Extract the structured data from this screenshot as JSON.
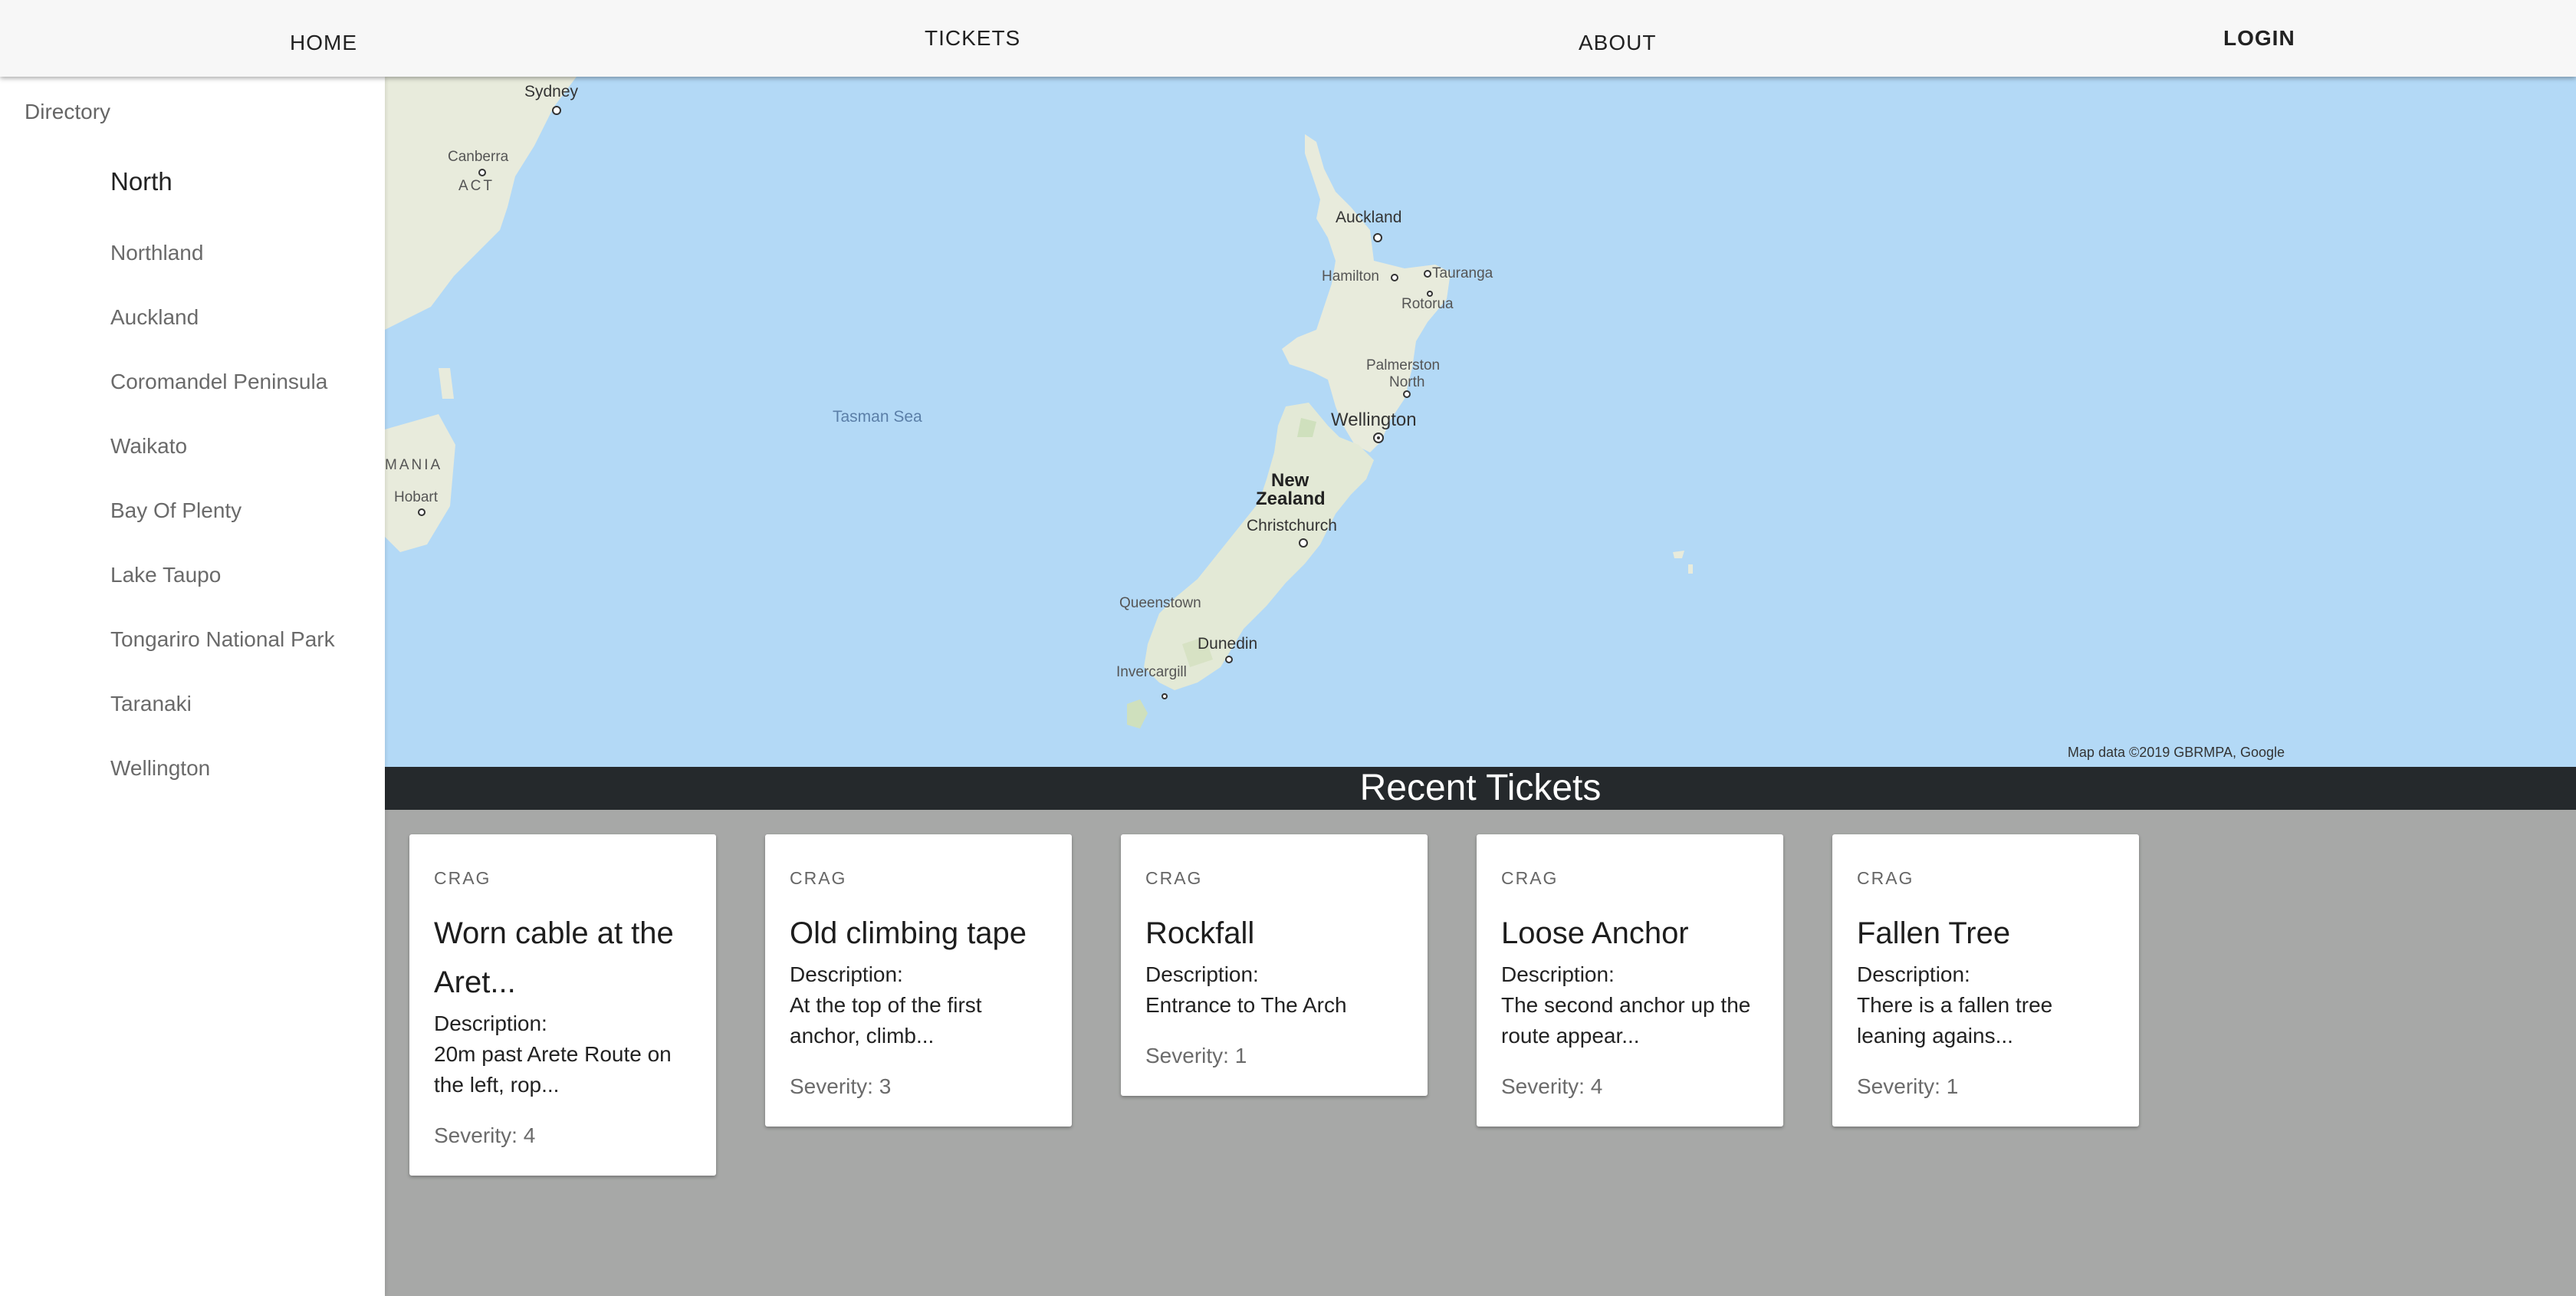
{
  "nav": {
    "home": "HOME",
    "tickets": "TICKETS",
    "about": "ABOUT",
    "login": "LOGIN"
  },
  "sidebar": {
    "directory_label": "Directory",
    "header": "North",
    "items": [
      {
        "label": "Northland"
      },
      {
        "label": "Auckland"
      },
      {
        "label": "Coromandel Peninsula"
      },
      {
        "label": "Waikato"
      },
      {
        "label": "Bay Of Plenty"
      },
      {
        "label": "Lake Taupo"
      },
      {
        "label": "Tongariro National Park"
      },
      {
        "label": "Taranaki"
      },
      {
        "label": "Wellington"
      }
    ]
  },
  "map": {
    "labels": {
      "sydney": "Sydney",
      "canberra": "Canberra",
      "act": "ACT",
      "tasmania": "MANIA",
      "hobart": "Hobart",
      "tasman_sea": "Tasman Sea",
      "auckland": "Auckland",
      "hamilton": "Hamilton",
      "tauranga": "Tauranga",
      "rotorua": "Rotorua",
      "palmerston": "Palmerston",
      "north": "North",
      "wellington": "Wellington",
      "new": "New",
      "zealand": "Zealand",
      "christchurch": "Christchurch",
      "queenstown": "Queenstown",
      "dunedin": "Dunedin",
      "invercargill": "Invercargill"
    },
    "attribution": "Map data ©2019 GBRMPA, Google",
    "colors": {
      "water": "#b3d9f6",
      "land": "#e9ecdc"
    }
  },
  "recent": {
    "title": "Recent Tickets",
    "cards": [
      {
        "category": "CRAG",
        "title": "Worn cable at the Aret...",
        "desc_label": "Description:",
        "desc": "20m past Arete Route on the left, rop...",
        "severity": "Severity: 4"
      },
      {
        "category": "CRAG",
        "title": "Old climbing tape",
        "desc_label": "Description:",
        "desc": "At the top of the first anchor, climb...",
        "severity": "Severity: 3"
      },
      {
        "category": "CRAG",
        "title": "Rockfall",
        "desc_label": "Description:",
        "desc": "Entrance to The Arch",
        "severity": "Severity: 1"
      },
      {
        "category": "CRAG",
        "title": "Loose Anchor",
        "desc_label": "Description:",
        "desc": "The second anchor up the route appear...",
        "severity": "Severity: 4"
      },
      {
        "category": "CRAG",
        "title": "Fallen Tree",
        "desc_label": "Description:",
        "desc": "There is a fallen tree leaning agains...",
        "severity": "Severity: 1"
      }
    ]
  }
}
